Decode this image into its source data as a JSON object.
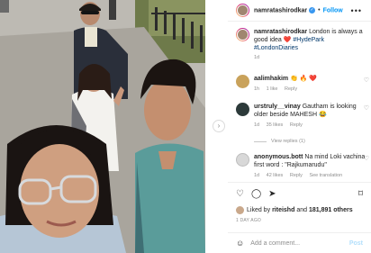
{
  "post": {
    "username": "namratashirodkar",
    "follow_label": "Follow",
    "dot": "•",
    "more": "•••",
    "caption_text": "London is always a good idea ❤️",
    "caption_tags": "#HydePark #LondonDiaries",
    "caption_age": "1d"
  },
  "comments": [
    {
      "user": "aalimhakim",
      "text": "👏 🔥 ❤️",
      "time": "1h",
      "likes": "1 like",
      "reply": "Reply"
    },
    {
      "user": "urstruly__vinay",
      "text": "Gautham is looking older beside MAHESH 😂",
      "time": "1d",
      "likes": "35 likes",
      "reply": "Reply"
    },
    {
      "user": "anonymous.bott",
      "text": "Na mind Loki vachina first word : \"Rajkumarudu\"",
      "time": "1d",
      "likes": "42 likes",
      "reply": "Reply",
      "translation": "See translation"
    }
  ],
  "view_replies": "View replies (1)",
  "icons": {
    "heart": "♡",
    "comment": "◯",
    "share": "➤",
    "bookmark": "⌑",
    "emoji": "☺",
    "next": "›"
  },
  "likes_line": {
    "prefix": "Liked by ",
    "user": "riteishd",
    "middle": " and ",
    "count": "181,891 others"
  },
  "timestamp": "1 DAY AGO",
  "add_comment": {
    "placeholder": "Add a comment...",
    "post_label": "Post"
  }
}
